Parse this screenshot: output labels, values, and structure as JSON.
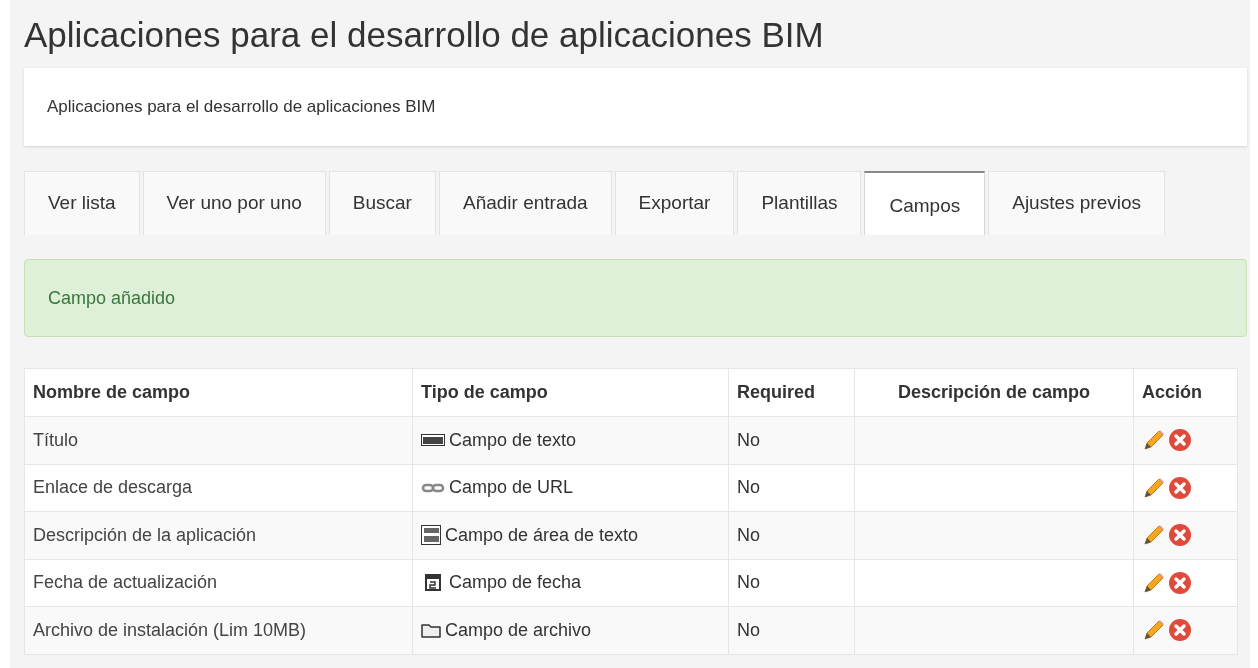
{
  "title": "Aplicaciones para el desarrollo de aplicaciones BIM",
  "description": "Aplicaciones para el desarrollo de aplicaciones BIM",
  "tabs": [
    {
      "label": "Ver lista",
      "selected": false
    },
    {
      "label": "Ver uno por uno",
      "selected": false
    },
    {
      "label": "Buscar",
      "selected": false
    },
    {
      "label": "Añadir entrada",
      "selected": false
    },
    {
      "label": "Exportar",
      "selected": false
    },
    {
      "label": "Plantillas",
      "selected": false
    },
    {
      "label": "Campos",
      "selected": true
    },
    {
      "label": "Ajustes previos",
      "selected": false
    }
  ],
  "alert": "Campo añadido",
  "table": {
    "columns": [
      "Nombre de campo",
      "Tipo de campo",
      "Required",
      "Descripción de campo",
      "Acción"
    ],
    "rows": [
      {
        "name": "Título",
        "type": "Campo de texto",
        "kind": "text",
        "required": "No"
      },
      {
        "name": "Enlace de descarga",
        "type": "Campo de URL",
        "kind": "url",
        "required": "No"
      },
      {
        "name": "Descripción de la aplicación",
        "type": "Campo de área de texto",
        "kind": "textarea",
        "required": "No"
      },
      {
        "name": "Fecha de actualización",
        "type": "Campo de fecha",
        "kind": "date",
        "required": "No"
      },
      {
        "name": "Archivo de instalación (Lim 10MB)",
        "type": "Campo de archivo",
        "kind": "file",
        "required": "No"
      }
    ]
  }
}
